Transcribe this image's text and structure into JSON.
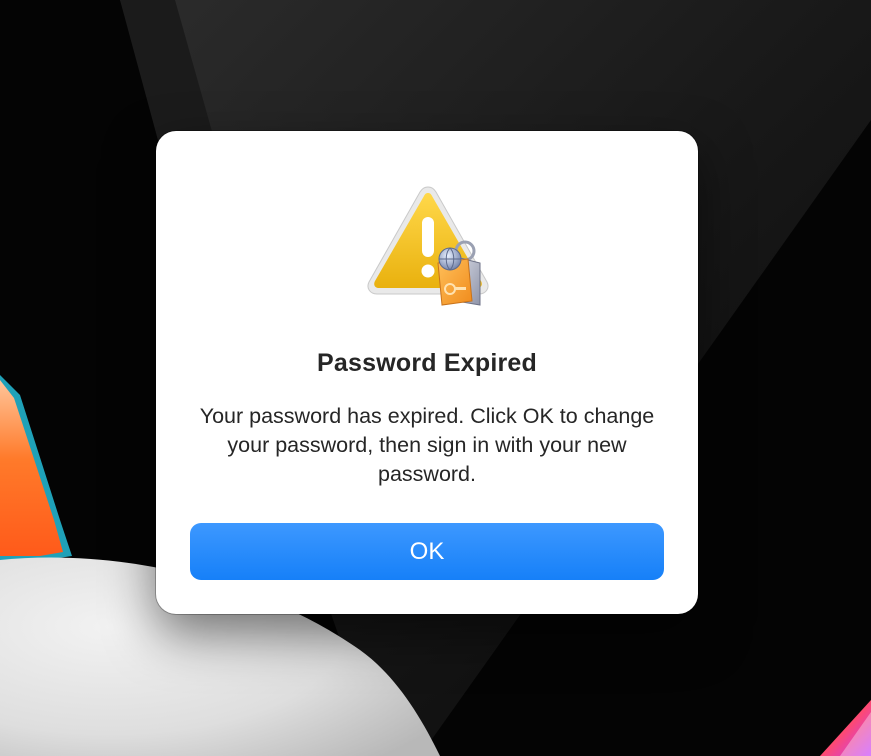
{
  "dialog": {
    "icon": "warning-keychain-icon",
    "title": "Password Expired",
    "message": "Your password has expired. Click OK to change your password, then sign in with your new password.",
    "ok_label": "OK"
  },
  "colors": {
    "button_accent": "#1a84fa",
    "warning_yellow": "#f2c21c",
    "dialog_background": "#ffffff",
    "desktop_background": "#050505"
  }
}
